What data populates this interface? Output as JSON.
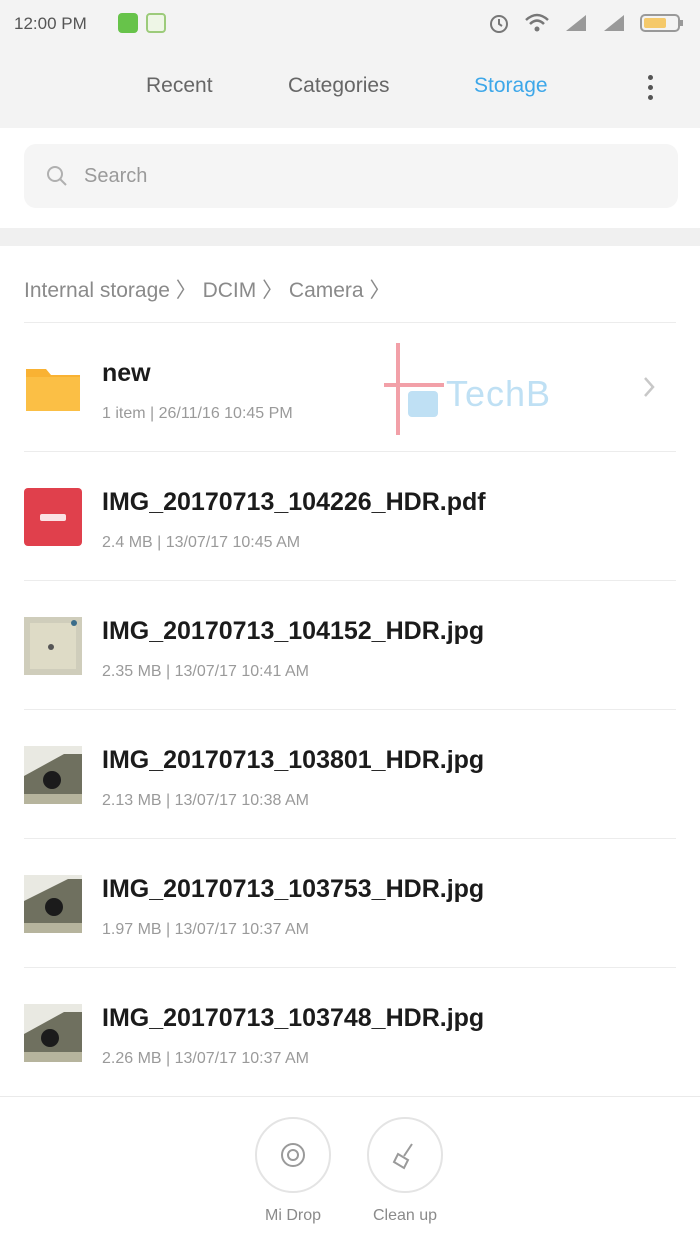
{
  "statusbar": {
    "time": "12:00 PM"
  },
  "tabs": [
    {
      "label": "Recent"
    },
    {
      "label": "Categories"
    },
    {
      "label": "Storage"
    }
  ],
  "search": {
    "placeholder": "Search"
  },
  "breadcrumb": "Internal storage  〉 DCIM  〉 Camera  〉",
  "watermark": {
    "text": "TechB"
  },
  "files": [
    {
      "name": "new",
      "meta": "1 item  |  26/11/16 10:45 PM",
      "type": "folder"
    },
    {
      "name": "IMG_20170713_104226_HDR.pdf",
      "meta": "2.4 MB  |  13/07/17 10:45 AM",
      "type": "pdf"
    },
    {
      "name": "IMG_20170713_104152_HDR.jpg",
      "meta": "2.35 MB  |  13/07/17 10:41 AM",
      "type": "image"
    },
    {
      "name": "IMG_20170713_103801_HDR.jpg",
      "meta": "2.13 MB  |  13/07/17 10:38 AM",
      "type": "image"
    },
    {
      "name": "IMG_20170713_103753_HDR.jpg",
      "meta": "1.97 MB  |  13/07/17 10:37 AM",
      "type": "image"
    },
    {
      "name": "IMG_20170713_103748_HDR.jpg",
      "meta": "2.26 MB  |  13/07/17 10:37 AM",
      "type": "image"
    }
  ],
  "bottom_actions": [
    {
      "label": "Mi Drop"
    },
    {
      "label": "Clean up"
    }
  ],
  "colors": {
    "accent": "#3da7e9",
    "folder": "#f9b233",
    "pdf": "#e0404c"
  }
}
